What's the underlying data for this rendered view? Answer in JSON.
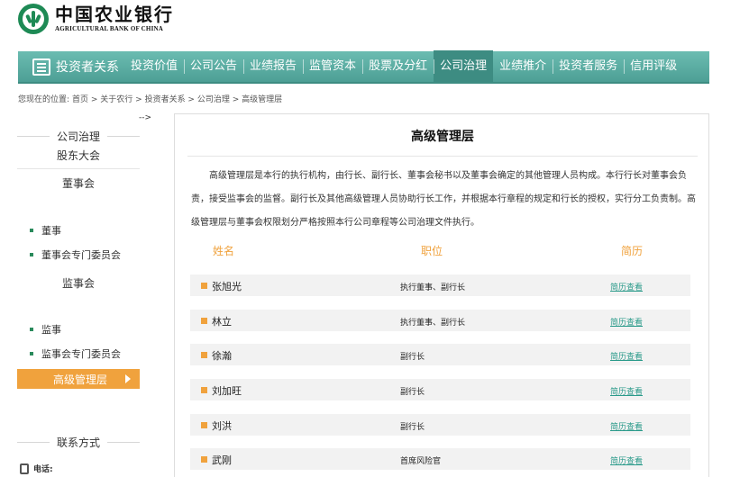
{
  "logo": {
    "cn": "中国农业银行",
    "en": "AGRICULTURAL BANK OF CHINA"
  },
  "nav": {
    "home_label": "投资者关系",
    "items": [
      "投资价值",
      "公司公告",
      "业绩报告",
      "监管资本",
      "股票及分红",
      "公司治理",
      "业绩推介",
      "投资者服务",
      "信用评级"
    ],
    "active_index": 5
  },
  "breadcrumb": {
    "prefix": "您现在的位置:",
    "path": "首页 > 关于农行 > 投资者关系 > 公司治理 > 高级管理层"
  },
  "stray_text": "-->",
  "sidebar": {
    "heading": "公司治理",
    "shareholders": "股东大会",
    "board": "董事会",
    "board_links": [
      "董事",
      "董事会专门委员会"
    ],
    "supervisory": "监事会",
    "supervisory_links": [
      "监事",
      "监事会专门委员会"
    ],
    "active": "高级管理层",
    "contact_heading": "联系方式",
    "tel_label": "电话:"
  },
  "main": {
    "title": "高级管理层",
    "intro": "高级管理层是本行的执行机构，由行长、副行长、董事会秘书以及董事会确定的其他管理人员构成。本行行长对董事会负责，接受监事会的监督。副行长及其他高级管理人员协助行长工作，并根据本行章程的规定和行长的授权，实行分工负责制。高级管理层与董事会权限划分严格按照本行公司章程等公司治理文件执行。",
    "columns": {
      "name": "姓名",
      "position": "职位",
      "cv": "简历"
    },
    "rows": [
      {
        "name": "张旭光",
        "position": "执行董事、副行长",
        "cv": "简历查看"
      },
      {
        "name": "林立",
        "position": "执行董事、副行长",
        "cv": "简历查看"
      },
      {
        "name": "徐瀚",
        "position": "副行长",
        "cv": "简历查看"
      },
      {
        "name": "刘加旺",
        "position": "副行长",
        "cv": "简历查看"
      },
      {
        "name": "刘洪",
        "position": "副行长",
        "cv": "简历查看"
      },
      {
        "name": "武刚",
        "position": "首席风险官",
        "cv": "简历查看"
      }
    ]
  },
  "colors": {
    "nav_bg": "#5aaba1",
    "nav_active": "#3d8c82",
    "accent_orange": "#f0a23d",
    "link_teal": "#2a9a8a",
    "brand_green": "#1e8a55"
  }
}
